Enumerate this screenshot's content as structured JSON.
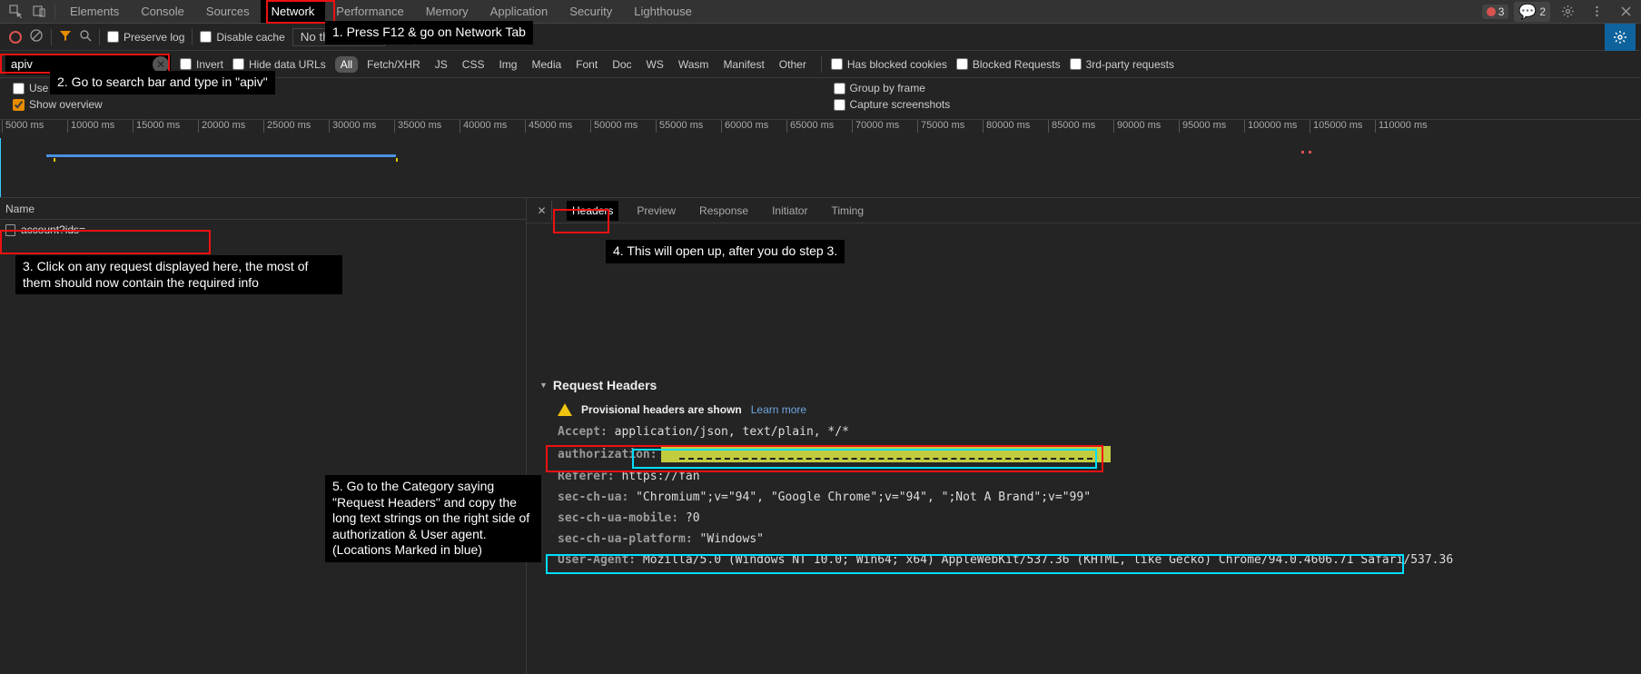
{
  "tabs": {
    "items": [
      "Elements",
      "Console",
      "Sources",
      "Network",
      "Performance",
      "Memory",
      "Application",
      "Security",
      "Lighthouse"
    ],
    "active": "Network"
  },
  "errors_badge": "3",
  "issues_badge": "2",
  "toolbar": {
    "preserve_log": "Preserve log",
    "disable_cache": "Disable cache",
    "throttling": "No throttling"
  },
  "filter": {
    "value": "apiv",
    "invert": "Invert",
    "hide_data_urls": "Hide data URLs",
    "types": [
      "All",
      "Fetch/XHR",
      "JS",
      "CSS",
      "Img",
      "Media",
      "Font",
      "Doc",
      "WS",
      "Wasm",
      "Manifest",
      "Other"
    ],
    "active_type": "All",
    "blocked_cookies": "Has blocked cookies",
    "blocked_requests": "Blocked Requests",
    "third_party": "3rd-party requests"
  },
  "options": {
    "large_rows": "Use large request rows",
    "show_overview": "Show overview",
    "group_by_frame": "Group by frame",
    "capture_screenshots": "Capture screenshots"
  },
  "timeline": {
    "ticks": [
      "5000 ms",
      "10000 ms",
      "15000 ms",
      "20000 ms",
      "25000 ms",
      "30000 ms",
      "35000 ms",
      "40000 ms",
      "45000 ms",
      "50000 ms",
      "55000 ms",
      "60000 ms",
      "65000 ms",
      "70000 ms",
      "75000 ms",
      "80000 ms",
      "85000 ms",
      "90000 ms",
      "95000 ms",
      "100000 ms",
      "105000 ms",
      "110000 ms"
    ]
  },
  "requests": {
    "column_name": "Name",
    "items": [
      "account?ids="
    ]
  },
  "detail_tabs": {
    "items": [
      "Headers",
      "Preview",
      "Response",
      "Initiator",
      "Timing"
    ],
    "active": "Headers"
  },
  "headers_section": {
    "title": "Request Headers",
    "provisional": "Provisional headers are shown",
    "learn_more": "Learn more",
    "kv": {
      "accept_k": "Accept:",
      "accept_v": "application/json, text/plain, */*",
      "auth_k": "authorization:",
      "referer_k": "Referer:",
      "referer_v": "https://fan",
      "secchua_k": "sec-ch-ua:",
      "secchua_v": "\"Chromium\";v=\"94\", \"Google Chrome\";v=\"94\", \";Not A Brand\";v=\"99\"",
      "secchuam_k": "sec-ch-ua-mobile:",
      "secchuam_v": "?0",
      "secchuap_k": "sec-ch-ua-platform:",
      "secchuap_v": "\"Windows\"",
      "ua_k": "User-Agent:",
      "ua_v": "Mozilla/5.0 (Windows NT 10.0; Win64; x64) AppleWebKit/537.36 (KHTML, like Gecko) Chrome/94.0.4606.71 Safari/537.36"
    }
  },
  "annotations": {
    "a1": "1. Press F12 & go on Network Tab",
    "a2": "2. Go to search bar and type in \"apiv\"",
    "a3": "3. Click on any request displayed here, the most of them should now contain the required info",
    "a4": "4. This will open up, after you do step 3.",
    "a5": "5. Go to the Category saying \"Request Headers\" and copy the long text strings on the right side of authorization & User agent. (Locations Marked in blue)"
  }
}
